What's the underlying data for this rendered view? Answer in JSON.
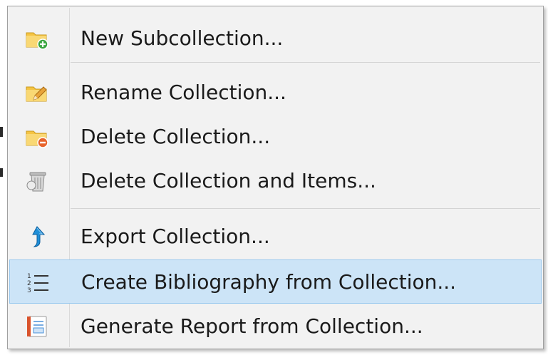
{
  "menu": {
    "items": [
      {
        "label": "New Subcollection...",
        "icon": "folder-add-icon",
        "highlighted": false
      },
      {
        "label": "Rename Collection...",
        "icon": "folder-rename-icon",
        "highlighted": false
      },
      {
        "label": "Delete Collection...",
        "icon": "folder-delete-icon",
        "highlighted": false
      },
      {
        "label": "Delete Collection and Items...",
        "icon": "trash-can-icon",
        "highlighted": false
      },
      {
        "label": "Export Collection...",
        "icon": "export-arrow-icon",
        "highlighted": false
      },
      {
        "label": "Create Bibliography from Collection...",
        "icon": "numbered-list-icon",
        "highlighted": true
      },
      {
        "label": "Generate Report from Collection...",
        "icon": "report-notebook-icon",
        "highlighted": false
      }
    ]
  },
  "colors": {
    "menu_background": "#f2f2f2",
    "highlight_background": "#cce4f7",
    "highlight_border": "#99c9ef",
    "folder": "#f5c443",
    "add_green": "#3aa640",
    "delete_orange": "#e8642c",
    "export_blue": "#1f8fd8"
  }
}
